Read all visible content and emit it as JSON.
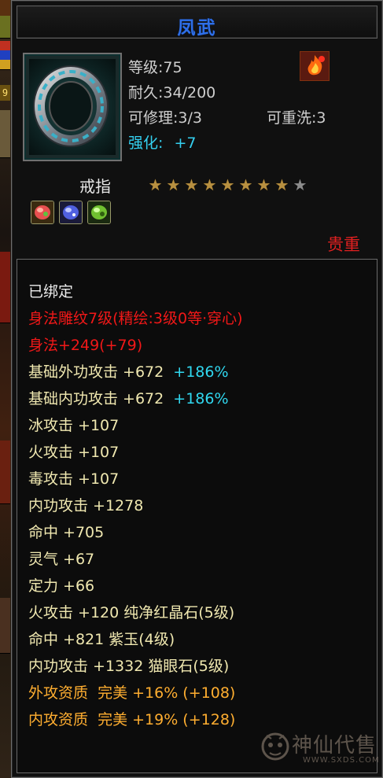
{
  "item": {
    "name": "凤武",
    "level": "等级:75",
    "durability": "耐久:34/200",
    "repairable": "可修理:3/3",
    "rewashable": "可重洗:3",
    "enhance_label": "强化:",
    "enhance_value": "+7",
    "type": "戒指",
    "stars_total": 9,
    "stars_filled": 8,
    "rarity": "贵重",
    "icon": "ring-icon",
    "badge_icon": "flame-emblem-icon",
    "gems": [
      "red-gem-icon",
      "blue-gem-icon",
      "green-gem-icon"
    ]
  },
  "properties": {
    "bound": "已绑定",
    "engrave": "身法雕纹7级(精绘:3级0等·穿心)",
    "agility": "身法+249(+79)",
    "base_outer_attack": "基础外功攻击 +672",
    "base_outer_attack_pct": "+186%",
    "base_inner_attack": "基础内功攻击 +672",
    "base_inner_attack_pct": "+186%",
    "ice_attack": "冰攻击 +107",
    "fire_attack": "火攻击 +107",
    "poison_attack": "毒攻击 +107",
    "inner_attack": "内功攻击 +1278",
    "hit": "命中 +705",
    "spirit": "灵气 +67",
    "focus": "定力 +66",
    "gem_fire": "火攻击 +120 纯净红晶石(5级)",
    "gem_hit": "命中 +821 紫玉(4级)",
    "gem_inner": "内功攻击 +1332 猫眼石(5级)",
    "outer_quality": "外攻资质  完美 +16% (+108)",
    "inner_quality": "内攻资质  完美 +19% (+128)"
  },
  "watermark": {
    "text": "神仙代售",
    "url": "WWW.SXDS.COM"
  },
  "colors": {
    "title": "#2e6fe8",
    "red": "#f01818",
    "cyan": "#30d8f0",
    "orange": "#ffae30",
    "star_on": "#b89040",
    "star_off": "#8c8c8c"
  }
}
